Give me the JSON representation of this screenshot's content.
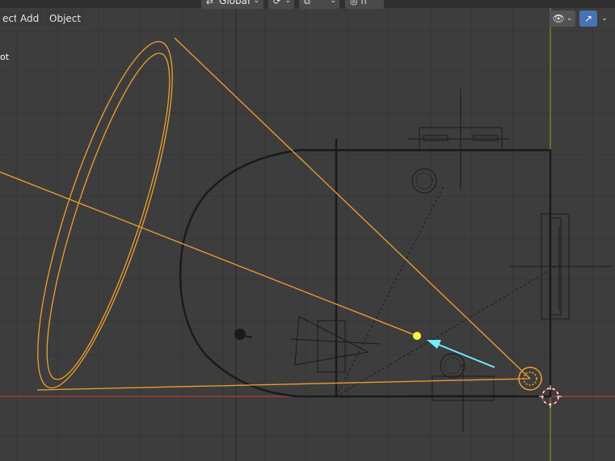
{
  "header": {
    "menu": [
      "ect",
      "Add",
      "Object"
    ],
    "transform_orientation": "Global",
    "pivot_label": "",
    "snap_label": ""
  },
  "side_label": "ot",
  "icons": [
    "orientation-icon",
    "pivot-icon",
    "snap-icon",
    "proportional-icon",
    "visibility-icon",
    "gizmo-icon",
    "chevron-down-icon"
  ],
  "colors": {
    "background": "#3d3d3d",
    "grid": "#353535",
    "grid_major": "#2f2f2f",
    "x_axis": "#b33b3b",
    "y_axis": "#6b9d1e",
    "selected": "#f0a030",
    "wire": "#1a1a1a",
    "light_direction": "#6ff0ff",
    "gizmo_active": "#4772b3"
  }
}
